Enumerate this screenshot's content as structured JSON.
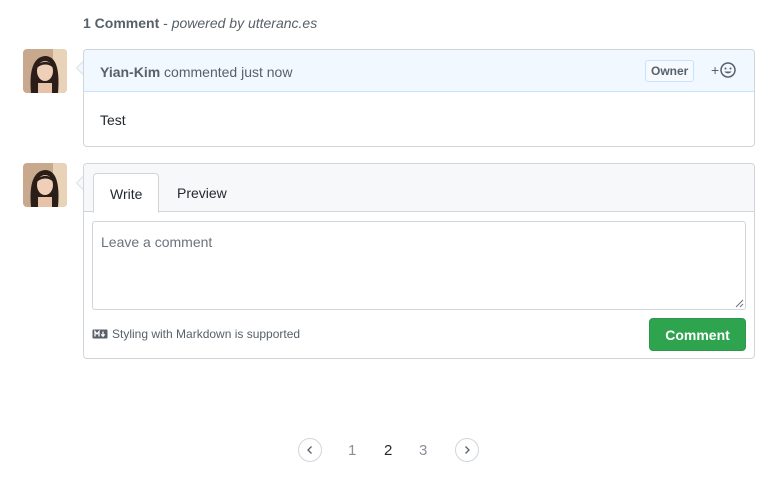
{
  "header": {
    "count": "1 Comment",
    "separator": " - ",
    "powered": "powered by utteranc.es"
  },
  "comment": {
    "author": "Yian-Kim",
    "meta": " commented just now",
    "badge": "Owner",
    "reaction_plus": "+",
    "reaction_icon": "smiley-icon",
    "body": "Test"
  },
  "form": {
    "tabs": [
      {
        "label": "Write"
      },
      {
        "label": "Preview"
      }
    ],
    "placeholder": "Leave a comment",
    "markdown_note": "Styling with Markdown is supported",
    "markdown_icon": "markdown-icon",
    "submit_label": "Comment"
  },
  "pagination": {
    "pages": [
      "1",
      "2",
      "3"
    ],
    "current": "2"
  },
  "colors": {
    "accent_green": "#2ea44f",
    "header_blue": "#f1f8ff",
    "border": "#d1d5da"
  }
}
